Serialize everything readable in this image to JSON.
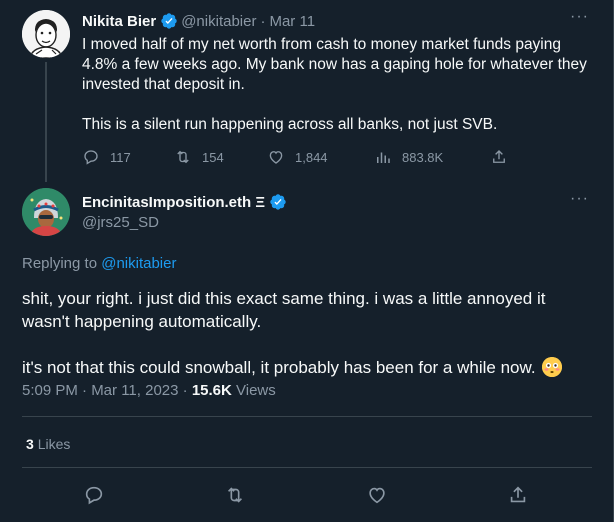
{
  "parent_tweet": {
    "author_name": "Nikita Bier",
    "handle": "@nikitabier",
    "date": "Mar 11",
    "text": "I moved half of my net worth from cash to money market funds paying 4.8% a few weeks ago. My bank now has a gaping hole for whatever they invested that deposit in.\n\nThis is a silent run happening across all banks, not just SVB.",
    "stats": {
      "replies": "117",
      "retweets": "154",
      "likes": "1,844",
      "views": "883.8K"
    }
  },
  "main_tweet": {
    "author_name": "EncinitasImposition.eth Ξ",
    "handle": "@jrs25_SD",
    "replying_prefix": "Replying to",
    "replying_to": "@nikitabier",
    "paragraph1": "shit, your right. i just did this exact same thing. i was a little annoyed it wasn't happening automatically.",
    "paragraph2": "it's not that this could snowball, it probably has been for a while now.",
    "timestamp": "5:09 PM · Mar 11, 2023",
    "views_count": "15.6K",
    "views_label": "Views",
    "likes_count": "3",
    "likes_label": "Likes"
  },
  "colors": {
    "background": "#15202b",
    "text": "#f7f9f9",
    "muted": "#8b98a5",
    "accent": "#1d9bf0",
    "divider": "#38444d"
  },
  "icons": [
    "reply-icon",
    "retweet-icon",
    "like-icon",
    "views-icon",
    "share-icon",
    "verified-icon",
    "more-icon",
    "flushed-face-emoji"
  ]
}
